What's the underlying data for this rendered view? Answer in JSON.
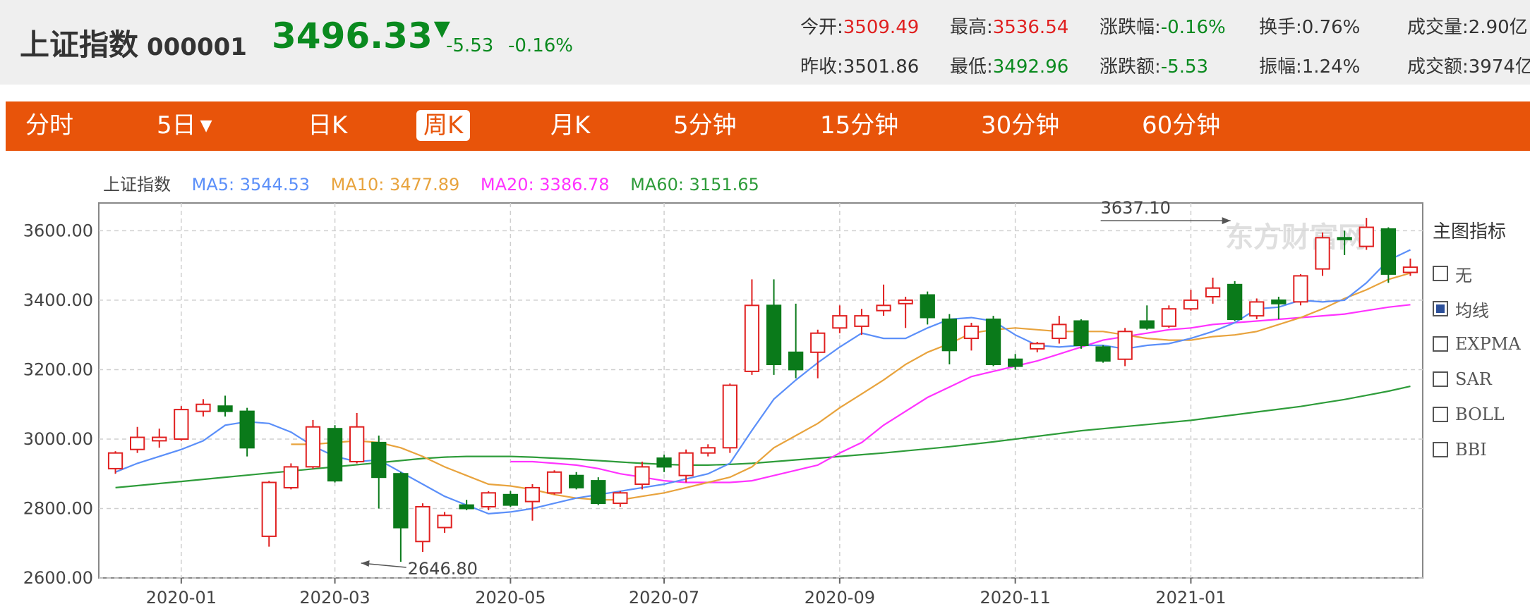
{
  "header": {
    "stock_name": "上证指数",
    "stock_code": "000001",
    "price": "3496.33",
    "arrow": "▼",
    "change": "-5.53",
    "change_pct": "-0.16%",
    "stats": {
      "open_label": "今开:",
      "open": "3509.49",
      "high_label": "最高:",
      "high": "3536.54",
      "chg_pct_label": "涨跌幅:",
      "chg_pct": "-0.16%",
      "turnover_label": "换手:",
      "turnover": "0.76%",
      "volume_label": "成交量:",
      "volume": "2.90亿",
      "prev_close_label": "昨收:",
      "prev_close": "3501.86",
      "low_label": "最低:",
      "low": "3492.96",
      "chg_amt_label": "涨跌额:",
      "chg_amt": "-5.53",
      "amplitude_label": "振幅:",
      "amplitude": "1.24%",
      "amount_label": "成交额:",
      "amount": "3974亿"
    }
  },
  "tabs": [
    {
      "label": "分时"
    },
    {
      "label": "5日",
      "caret": "▼"
    },
    {
      "label": "日K"
    },
    {
      "label": "周K",
      "active": true
    },
    {
      "label": "月K"
    },
    {
      "label": "5分钟"
    },
    {
      "label": "15分钟"
    },
    {
      "label": "30分钟"
    },
    {
      "label": "60分钟"
    }
  ],
  "legend": {
    "name": "上证指数",
    "ma5": "MA5: 3544.53",
    "ma10": "MA10: 3477.89",
    "ma20": "MA20: 3386.78",
    "ma60": "MA60: 3151.65"
  },
  "colors": {
    "up": "#e02020",
    "down": "#0a7a1a",
    "ma5": "#5b8ff9",
    "ma10": "#e8a33d",
    "ma20": "#ff33ff",
    "ma60": "#2e9c3a",
    "tab_bg": "#e8540a"
  },
  "indicator_panel": {
    "title": "主图指标",
    "items": [
      {
        "label": "无",
        "checked": false
      },
      {
        "label": "均线",
        "checked": true
      },
      {
        "label": "EXPMA",
        "checked": false
      },
      {
        "label": "SAR",
        "checked": false
      },
      {
        "label": "BOLL",
        "checked": false
      },
      {
        "label": "BBI",
        "checked": false
      }
    ]
  },
  "chart_data": {
    "type": "candlestick",
    "ylim": [
      2600,
      3680
    ],
    "y_ticks": [
      "3600.00",
      "3400.00",
      "3200.00",
      "3000.00",
      "2800.00",
      "2600.00"
    ],
    "x_ticks": [
      {
        "label": "2020-01",
        "index": 3
      },
      {
        "label": "2020-03",
        "index": 10
      },
      {
        "label": "2020-05",
        "index": 18
      },
      {
        "label": "2020-07",
        "index": 25
      },
      {
        "label": "2020-09",
        "index": 33
      },
      {
        "label": "2020-11",
        "index": 41
      },
      {
        "label": "2021-01",
        "index": 49
      }
    ],
    "annotations": {
      "high": {
        "label": "3637.10",
        "index": 51,
        "value": 3637.1
      },
      "low": {
        "label": "2646.80",
        "index": 11,
        "value": 2646.8
      }
    },
    "watermark": "东方财富网",
    "candles": [
      [
        2915,
        2960,
        2900,
        2965
      ],
      [
        2970,
        3005,
        2960,
        3035
      ],
      [
        2995,
        3005,
        2975,
        3030
      ],
      [
        3000,
        3085,
        2995,
        3095
      ],
      [
        3080,
        3100,
        3065,
        3115
      ],
      [
        3095,
        3080,
        3065,
        3125
      ],
      [
        3080,
        2975,
        2950,
        3090
      ],
      [
        2720,
        2875,
        2690,
        2880
      ],
      [
        2860,
        2920,
        2855,
        2930
      ],
      [
        2920,
        3035,
        2915,
        3055
      ],
      [
        3030,
        2880,
        2875,
        3040
      ],
      [
        2935,
        3035,
        2930,
        3075
      ],
      [
        2990,
        2890,
        2800,
        3010
      ],
      [
        2900,
        2745,
        2646.8,
        2905
      ],
      [
        2705,
        2805,
        2675,
        2815
      ],
      [
        2745,
        2780,
        2730,
        2790
      ],
      [
        2810,
        2800,
        2795,
        2825
      ],
      [
        2805,
        2845,
        2795,
        2850
      ],
      [
        2840,
        2810,
        2805,
        2850
      ],
      [
        2820,
        2860,
        2765,
        2870
      ],
      [
        2845,
        2905,
        2840,
        2910
      ],
      [
        2895,
        2860,
        2855,
        2905
      ],
      [
        2880,
        2815,
        2810,
        2890
      ],
      [
        2815,
        2845,
        2805,
        2850
      ],
      [
        2870,
        2920,
        2855,
        2935
      ],
      [
        2945,
        2920,
        2905,
        2955
      ],
      [
        2895,
        2960,
        2875,
        2970
      ],
      [
        2960,
        2975,
        2950,
        2985
      ],
      [
        2975,
        3155,
        2960,
        3160
      ],
      [
        3195,
        3385,
        3185,
        3460
      ],
      [
        3385,
        3215,
        3185,
        3460
      ],
      [
        3250,
        3200,
        3175,
        3390
      ],
      [
        3250,
        3305,
        3175,
        3315
      ],
      [
        3320,
        3355,
        3305,
        3385
      ],
      [
        3325,
        3355,
        3300,
        3375
      ],
      [
        3370,
        3385,
        3355,
        3445
      ],
      [
        3390,
        3400,
        3320,
        3410
      ],
      [
        3415,
        3350,
        3330,
        3425
      ],
      [
        3345,
        3255,
        3215,
        3360
      ],
      [
        3290,
        3325,
        3255,
        3335
      ],
      [
        3345,
        3215,
        3210,
        3355
      ],
      [
        3230,
        3210,
        3200,
        3245
      ],
      [
        3260,
        3275,
        3250,
        3280
      ],
      [
        3290,
        3330,
        3275,
        3355
      ],
      [
        3340,
        3270,
        3260,
        3345
      ],
      [
        3265,
        3225,
        3220,
        3270
      ],
      [
        3230,
        3310,
        3210,
        3320
      ],
      [
        3340,
        3320,
        3315,
        3385
      ],
      [
        3325,
        3375,
        3320,
        3385
      ],
      [
        3375,
        3400,
        3370,
        3430
      ],
      [
        3410,
        3435,
        3390,
        3465
      ],
      [
        3445,
        3345,
        3340,
        3455
      ],
      [
        3355,
        3395,
        3345,
        3405
      ],
      [
        3400,
        3390,
        3345,
        3410
      ],
      [
        3395,
        3470,
        3385,
        3475
      ],
      [
        3490,
        3580,
        3470,
        3595
      ],
      [
        3580,
        3575,
        3530,
        3600
      ],
      [
        3555,
        3610,
        3545,
        3637.1
      ],
      [
        3605,
        3475,
        3450,
        3610
      ],
      [
        3480,
        3495,
        3470,
        3520
      ]
    ],
    "ma5": [
      2905,
      2930,
      2950,
      2970,
      2995,
      3040,
      3050,
      3045,
      3020,
      2980,
      2950,
      2935,
      2940,
      2905,
      2870,
      2835,
      2810,
      2785,
      2790,
      2800,
      2815,
      2830,
      2840,
      2850,
      2860,
      2870,
      2885,
      2900,
      2930,
      3025,
      3115,
      3170,
      3220,
      3265,
      3305,
      3290,
      3290,
      3320,
      3345,
      3350,
      3340,
      3300,
      3270,
      3265,
      3270,
      3270,
      3260,
      3270,
      3275,
      3290,
      3310,
      3335,
      3375,
      3380,
      3400,
      3395,
      3400,
      3450,
      3515,
      3545
    ],
    "ma10": [
      null,
      null,
      null,
      null,
      null,
      null,
      null,
      null,
      2985,
      2985,
      2990,
      2995,
      2990,
      2975,
      2950,
      2920,
      2895,
      2870,
      2865,
      2855,
      2840,
      2830,
      2825,
      2825,
      2835,
      2845,
      2860,
      2875,
      2890,
      2920,
      2975,
      3010,
      3045,
      3090,
      3130,
      3170,
      3215,
      3250,
      3275,
      3305,
      3315,
      3320,
      3315,
      3310,
      3310,
      3310,
      3300,
      3290,
      3285,
      3285,
      3295,
      3300,
      3310,
      3330,
      3350,
      3375,
      3405,
      3430,
      3460,
      3478
    ],
    "ma20": [
      null,
      null,
      null,
      null,
      null,
      null,
      null,
      null,
      null,
      null,
      null,
      null,
      null,
      null,
      null,
      null,
      null,
      null,
      2935,
      2935,
      2930,
      2925,
      2915,
      2900,
      2890,
      2880,
      2875,
      2875,
      2875,
      2880,
      2895,
      2910,
      2925,
      2960,
      2990,
      3040,
      3080,
      3120,
      3150,
      3180,
      3195,
      3210,
      3225,
      3245,
      3265,
      3285,
      3295,
      3305,
      3315,
      3320,
      3330,
      3335,
      3340,
      3345,
      3350,
      3355,
      3360,
      3370,
      3380,
      3387
    ],
    "ma60": [
      2860,
      2866,
      2872,
      2878,
      2884,
      2890,
      2896,
      2902,
      2908,
      2914,
      2920,
      2926,
      2932,
      2938,
      2944,
      2948,
      2950,
      2950,
      2950,
      2948,
      2945,
      2942,
      2938,
      2934,
      2930,
      2927,
      2925,
      2925,
      2927,
      2930,
      2935,
      2940,
      2945,
      2950,
      2955,
      2960,
      2966,
      2972,
      2978,
      2985,
      2992,
      3000,
      3008,
      3016,
      3024,
      3030,
      3036,
      3042,
      3048,
      3054,
      3062,
      3070,
      3078,
      3086,
      3094,
      3104,
      3114,
      3126,
      3138,
      3152
    ]
  }
}
